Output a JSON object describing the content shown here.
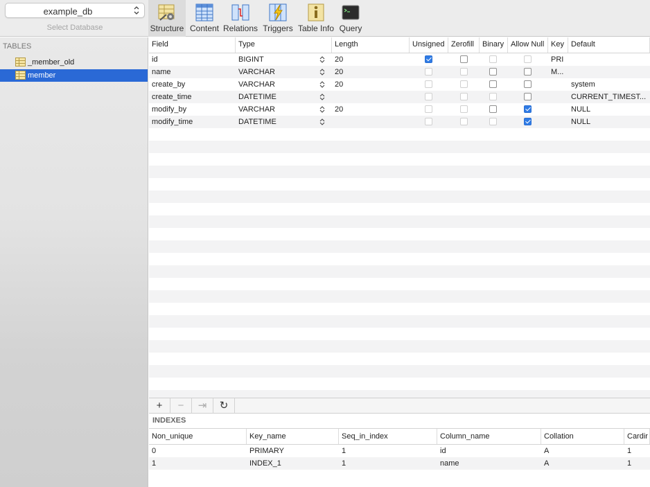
{
  "database": {
    "selected": "example_db",
    "select_label": "Select Database"
  },
  "toolbar": [
    {
      "label": "Structure",
      "icon": "structure-icon",
      "active": true
    },
    {
      "label": "Content",
      "icon": "content-icon",
      "active": false
    },
    {
      "label": "Relations",
      "icon": "relations-icon",
      "active": false
    },
    {
      "label": "Triggers",
      "icon": "triggers-icon",
      "active": false
    },
    {
      "label": "Table Info",
      "icon": "table-info-icon",
      "active": false
    },
    {
      "label": "Query",
      "icon": "query-icon",
      "active": false
    }
  ],
  "sidebar": {
    "header": "TABLES",
    "tables": [
      {
        "name": "_member_old",
        "selected": false
      },
      {
        "name": "member",
        "selected": true
      }
    ]
  },
  "structure": {
    "columns": [
      "Field",
      "Type",
      "Length",
      "Unsigned",
      "Zerofill",
      "Binary",
      "Allow Null",
      "Key",
      "Default"
    ],
    "rows": [
      {
        "field": "id",
        "type": "BIGINT",
        "length": "20",
        "unsigned": "checked",
        "zerofill": "enabled",
        "binary": "disabled",
        "allow_null": "disabled",
        "key": "PRI",
        "default": ""
      },
      {
        "field": "name",
        "type": "VARCHAR",
        "length": "20",
        "unsigned": "disabled",
        "zerofill": "disabled",
        "binary": "enabled",
        "allow_null": "enabled",
        "key": "M...",
        "default": ""
      },
      {
        "field": "create_by",
        "type": "VARCHAR",
        "length": "20",
        "unsigned": "disabled",
        "zerofill": "disabled",
        "binary": "enabled",
        "allow_null": "enabled",
        "key": "",
        "default": "system"
      },
      {
        "field": "create_time",
        "type": "DATETIME",
        "length": "",
        "unsigned": "disabled",
        "zerofill": "disabled",
        "binary": "disabled",
        "allow_null": "enabled",
        "key": "",
        "default": "CURRENT_TIMEST..."
      },
      {
        "field": "modify_by",
        "type": "VARCHAR",
        "length": "20",
        "unsigned": "disabled",
        "zerofill": "disabled",
        "binary": "enabled",
        "allow_null": "checked",
        "key": "",
        "default": "NULL"
      },
      {
        "field": "modify_time",
        "type": "DATETIME",
        "length": "",
        "unsigned": "disabled",
        "zerofill": "disabled",
        "binary": "disabled",
        "allow_null": "checked",
        "key": "",
        "default": "NULL"
      }
    ]
  },
  "mini_toolbar": [
    {
      "symbol": "+",
      "name": "add-field-button",
      "disabled": false
    },
    {
      "symbol": "−",
      "name": "remove-field-button",
      "disabled": true
    },
    {
      "symbol": "⇥",
      "name": "duplicate-field-button",
      "disabled": true
    },
    {
      "symbol": "↻",
      "name": "refresh-button",
      "disabled": false
    }
  ],
  "indexes": {
    "title": "INDEXES",
    "columns": [
      "Non_unique",
      "Key_name",
      "Seq_in_index",
      "Column_name",
      "Collation",
      "Cardir"
    ],
    "rows": [
      [
        "0",
        "PRIMARY",
        "1",
        "id",
        "A",
        "1"
      ],
      [
        "1",
        "INDEX_1",
        "1",
        "name",
        "A",
        "1"
      ]
    ]
  },
  "colors": {
    "selection": "#2a69d6",
    "checkbox_checked": "#2f7be5",
    "alt_row": "#f3f3f4"
  }
}
